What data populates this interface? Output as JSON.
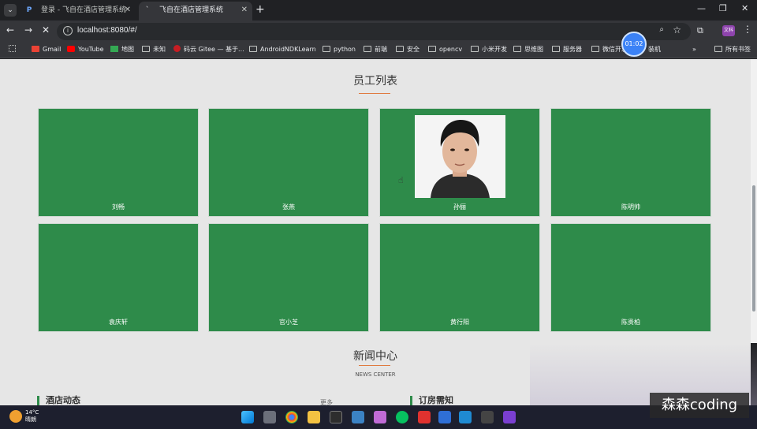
{
  "tabs": [
    {
      "title": "登录 - 飞自在酒店管理系统",
      "active": false
    },
    {
      "title": "飞自在酒店管理系统",
      "active": true
    }
  ],
  "toolbar": {
    "url": "localhost:8080/#/",
    "timer": "01:02",
    "profile": "文科"
  },
  "bookmarks": [
    {
      "label": "Gmail",
      "icon": "gmail-icon"
    },
    {
      "label": "YouTube",
      "icon": "youtube-icon"
    },
    {
      "label": "地图",
      "icon": "maps-icon"
    },
    {
      "label": "未知",
      "icon": "folder-icon"
    },
    {
      "label": "码云 Gitee — 基于...",
      "icon": "gitee-icon"
    },
    {
      "label": "AndroidNDKLearn",
      "icon": "folder-icon"
    },
    {
      "label": "python",
      "icon": "folder-icon"
    },
    {
      "label": "前端",
      "icon": "folder-icon"
    },
    {
      "label": "安全",
      "icon": "folder-icon"
    },
    {
      "label": "opencv",
      "icon": "folder-icon"
    },
    {
      "label": "小米开发",
      "icon": "folder-icon"
    },
    {
      "label": "思维图",
      "icon": "folder-icon"
    },
    {
      "label": "服务器",
      "icon": "folder-icon"
    },
    {
      "label": "微信开发",
      "icon": "folder-icon"
    },
    {
      "label": "装机",
      "icon": "folder-icon"
    },
    {
      "label": "所有书签",
      "icon": "folder-icon"
    }
  ],
  "staff": {
    "title": "员工列表",
    "members": [
      "刘畅",
      "张燕",
      "孙俪",
      "陈明帅",
      "袁庆轩",
      "官小芝",
      "黄行阳",
      "陈贵柏"
    ]
  },
  "news": {
    "title": "新闻中心",
    "subtitle": "NEWS CENTER",
    "col_left": "酒店动态",
    "more": "更多",
    "col_right": "订房需知"
  },
  "taskbar": {
    "temperature": "14°C",
    "weather": "晴朗",
    "badge": "7"
  },
  "watermark": "森森coding",
  "colors": {
    "card_green": "#2e8b4a",
    "accent_orange": "#e07a3f"
  }
}
